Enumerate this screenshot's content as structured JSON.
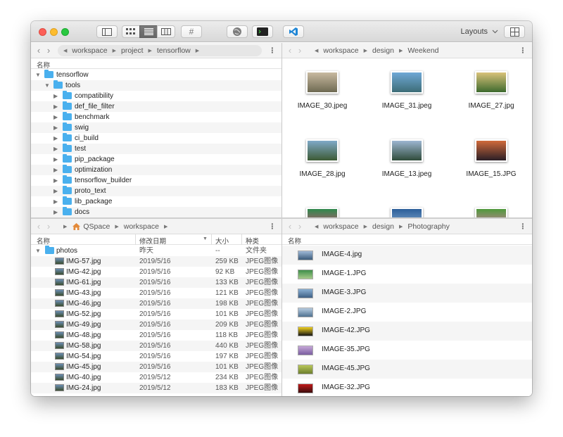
{
  "toolbar": {
    "layouts_label": "Layouts",
    "hash_label": "#",
    "icons": [
      "sidebar-icon",
      "icon-view-icon",
      "list-view-icon",
      "column-view-icon",
      "hash-icon",
      "globe-icon",
      "terminal-icon",
      "vscode-icon",
      "layout-grid-icon"
    ]
  },
  "pane_tl": {
    "path": [
      "workspace",
      "project",
      "tensorflow"
    ],
    "col_name": "名称",
    "rows": [
      {
        "label": "tensorflow",
        "level": 0,
        "expanded": true
      },
      {
        "label": "tools",
        "level": 1,
        "expanded": true
      },
      {
        "label": "compatibility",
        "level": 2
      },
      {
        "label": "def_file_filter",
        "level": 2
      },
      {
        "label": "benchmark",
        "level": 2
      },
      {
        "label": "swig",
        "level": 2
      },
      {
        "label": "ci_build",
        "level": 2
      },
      {
        "label": "test",
        "level": 2
      },
      {
        "label": "pip_package",
        "level": 2
      },
      {
        "label": "optimization",
        "level": 2
      },
      {
        "label": "tensorflow_builder",
        "level": 2
      },
      {
        "label": "proto_text",
        "level": 2
      },
      {
        "label": "lib_package",
        "level": 2
      },
      {
        "label": "docs",
        "level": 2
      }
    ]
  },
  "pane_tr": {
    "path": [
      "workspace",
      "design",
      "Weekend"
    ],
    "items": [
      {
        "name": "IMAGE_30.jpeg",
        "colors": [
          "#c8b9a0",
          "#6e6a52"
        ]
      },
      {
        "name": "IMAGE_31.jpeg",
        "colors": [
          "#6fa8d6",
          "#3d6d77"
        ]
      },
      {
        "name": "IMAGE_27.jpg",
        "colors": [
          "#d9c27a",
          "#3e6a2e"
        ]
      },
      {
        "name": "IMAGE_28.jpg",
        "colors": [
          "#7fa9c8",
          "#3c5a34"
        ]
      },
      {
        "name": "IMAGE_13.jpeg",
        "colors": [
          "#9db6d2",
          "#2f4b3a"
        ]
      },
      {
        "name": "IMAGE_15.JPG",
        "colors": [
          "#d06a3b",
          "#2a1e26"
        ]
      },
      {
        "name": "",
        "colors": [
          "#2f8a4d",
          "#d64a7a"
        ]
      },
      {
        "name": "",
        "colors": [
          "#2c5f99",
          "#8fb2d6"
        ]
      },
      {
        "name": "",
        "colors": [
          "#4f9a3c",
          "#e17bb0"
        ]
      }
    ]
  },
  "pane_bl": {
    "home": "QSpace",
    "path": [
      "workspace"
    ],
    "cols": {
      "name": "名称",
      "date": "修改日期",
      "size": "大小",
      "kind": "种类"
    },
    "folder": {
      "label": "photos",
      "date": "昨天",
      "size": "--",
      "kind": "文件夹"
    },
    "rows": [
      {
        "label": "IMG-57.jpg",
        "date": "2019/5/16",
        "size": "259 KB",
        "kind": "JPEG图像"
      },
      {
        "label": "IMG-42.jpg",
        "date": "2019/5/16",
        "size": "92 KB",
        "kind": "JPEG图像"
      },
      {
        "label": "IMG-61.jpg",
        "date": "2019/5/16",
        "size": "133 KB",
        "kind": "JPEG图像"
      },
      {
        "label": "IMG-43.jpg",
        "date": "2019/5/16",
        "size": "121 KB",
        "kind": "JPEG图像"
      },
      {
        "label": "IMG-46.jpg",
        "date": "2019/5/16",
        "size": "198 KB",
        "kind": "JPEG图像"
      },
      {
        "label": "IMG-52.jpg",
        "date": "2019/5/16",
        "size": "101 KB",
        "kind": "JPEG图像"
      },
      {
        "label": "IMG-49.jpg",
        "date": "2019/5/16",
        "size": "209 KB",
        "kind": "JPEG图像"
      },
      {
        "label": "IMG-48.jpg",
        "date": "2019/5/16",
        "size": "118 KB",
        "kind": "JPEG图像"
      },
      {
        "label": "IMG-58.jpg",
        "date": "2019/5/16",
        "size": "440 KB",
        "kind": "JPEG图像"
      },
      {
        "label": "IMG-54.jpg",
        "date": "2019/5/16",
        "size": "197 KB",
        "kind": "JPEG图像"
      },
      {
        "label": "IMG-45.jpg",
        "date": "2019/5/16",
        "size": "101 KB",
        "kind": "JPEG图像"
      },
      {
        "label": "IMG-40.jpg",
        "date": "2019/5/12",
        "size": "234 KB",
        "kind": "JPEG图像"
      },
      {
        "label": "IMG-24.jpg",
        "date": "2019/5/12",
        "size": "183 KB",
        "kind": "JPEG图像"
      }
    ]
  },
  "pane_br": {
    "path": [
      "workspace",
      "design",
      "Photography"
    ],
    "col_name": "名称",
    "rows": [
      {
        "label": "IMAGE-4.jpg",
        "colors": [
          "#9fb9d8",
          "#3b5b7a"
        ]
      },
      {
        "label": "IMAGE-1.JPG",
        "colors": [
          "#3f8f4a",
          "#a6c98a"
        ]
      },
      {
        "label": "IMAGE-3.JPG",
        "colors": [
          "#8ab0d4",
          "#3e5f84"
        ]
      },
      {
        "label": "IMAGE-2.JPG",
        "colors": [
          "#b7cce0",
          "#4f7190"
        ]
      },
      {
        "label": "IMAGE-42.JPG",
        "colors": [
          "#f2d21f",
          "#151515"
        ]
      },
      {
        "label": "IMAGE-35.JPG",
        "colors": [
          "#c6a7d8",
          "#7a5ea0"
        ]
      },
      {
        "label": "IMAGE-45.JPG",
        "colors": [
          "#b9c75a",
          "#6d7f2e"
        ]
      },
      {
        "label": "IMAGE-32.JPG",
        "colors": [
          "#c21a1a",
          "#3a0d0d"
        ]
      }
    ]
  }
}
